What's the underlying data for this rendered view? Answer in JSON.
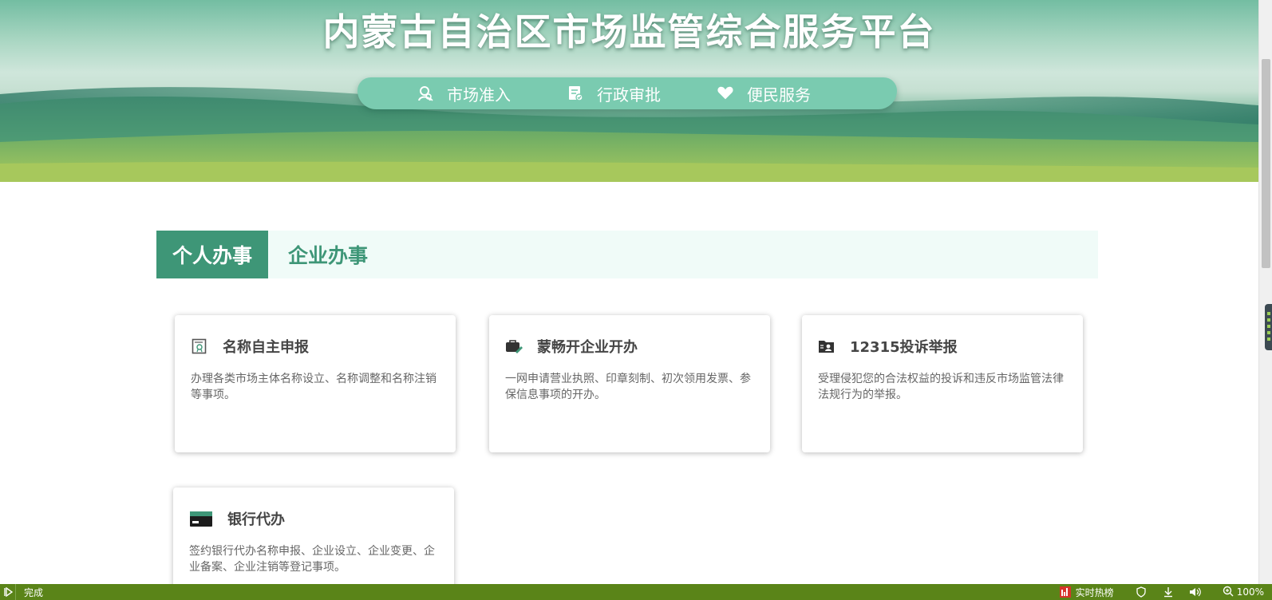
{
  "header": {
    "title": "内蒙古自治区市场监管综合服务平台",
    "nav": [
      {
        "label": "市场准入",
        "icon": "user-search-icon"
      },
      {
        "label": "行政审批",
        "icon": "document-approve-icon"
      },
      {
        "label": "便民服务",
        "icon": "heart-hand-icon"
      }
    ]
  },
  "tabs": [
    {
      "label": "个人办事",
      "active": true
    },
    {
      "label": "企业办事",
      "active": false
    }
  ],
  "cards": [
    {
      "title": "名称自主申报",
      "icon": "certificate-icon",
      "desc": "办理各类市场主体名称设立、名称调整和名称注销等事项。"
    },
    {
      "title": "蒙畅开企业开办",
      "icon": "briefcase-edit-icon",
      "desc": "一网申请营业执照、印章刻制、初次领用发票、参保信息事项的开办。"
    },
    {
      "title": "12315投诉举报",
      "icon": "folder-user-icon",
      "desc": "受理侵犯您的合法权益的投诉和违反市场监管法律法规行为的举报。"
    },
    {
      "title": "银行代办",
      "icon": "bank-card-icon",
      "desc": "签约银行代办名称申报、企业设立、企业变更、企业备案、企业注销等登记事项。"
    }
  ],
  "statusbar": {
    "status": "完成",
    "hot_label": "实时热榜",
    "zoom": "100%"
  },
  "colors": {
    "accent": "#3e9677",
    "nav_bar": "#7acbb0",
    "tab_bg": "#f0fbf8",
    "statusbar": "#5a8418"
  }
}
